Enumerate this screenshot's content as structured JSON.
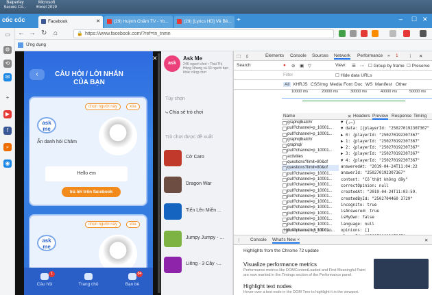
{
  "desktop": {
    "items": [
      {
        "label": "Balperfey\nSecure Co..."
      },
      {
        "label": "Microsoft\nExcel 2019"
      }
    ]
  },
  "browser": {
    "brand": "cốc cốc",
    "tabs": [
      {
        "label": "Facebook",
        "color": "#3b5998"
      },
      {
        "label": "(29) Huỳnh Chăm TV - Yo...",
        "color": "#e53935"
      },
      {
        "label": "(29) [Lyrics HD] Về Bê...",
        "color": "#e53935"
      }
    ],
    "new_tab": "+",
    "url": "https://www.facebook.com/?ref=tn_tnmn",
    "bookmark_label": "Ứng dụng"
  },
  "game": {
    "title": "CÂU HỎI / LỜI NHẮN CỦA BẠN",
    "back_icon": "‹",
    "card1": {
      "choose": "chọn người này",
      "delete": "xóa",
      "logo": "ask me",
      "prompt": "Ẩn danh hỏi Chăm",
      "answer": "Hello em",
      "fb_button": "trả lời trên facebook"
    },
    "card2": {
      "choose": "chọn người này",
      "delete": "xóa",
      "logo": "ask me"
    },
    "nav": [
      {
        "label": "Câu hỏi",
        "badge": "1"
      },
      {
        "label": "Trang chủ",
        "badge": ""
      },
      {
        "label": "Bạn bè",
        "badge": "84"
      }
    ]
  },
  "fb_sidebar": {
    "app_name": "Ask Me",
    "app_meta": "24K người chơi • Thái Thị Hồng Nhung và 30 người bạn khác cũng chơi",
    "section_options": "Tùy chọn",
    "share_label": "Chia sẻ trò chơi",
    "section_suggested": "Trò chơi được đề xuất",
    "games": [
      {
        "name": "Cờ Caro",
        "color": "#c0392b"
      },
      {
        "name": "Dragon War",
        "color": "#6d4c41"
      },
      {
        "name": "Tiến Lên Miền ...",
        "color": "#1565c0"
      },
      {
        "name": "Jumpy Jumpy - ...",
        "color": "#7cb342"
      },
      {
        "name": "Liêng - 3 Cây -...",
        "color": "#8e24aa"
      }
    ]
  },
  "devtools": {
    "main_tabs": [
      "Elements",
      "Console",
      "Sources",
      "Network",
      "Performance",
      "»"
    ],
    "errors": "1",
    "filter_placeholder": "Filter",
    "hide_data_urls": "Hide data URLs",
    "view_label": "View:",
    "group_by_frame": "Group by frame",
    "preserve_log": "Preserve",
    "search_label": "Search",
    "type_filters": [
      "All",
      "XHR",
      "JS",
      "CSS",
      "Img",
      "Media",
      "Font",
      "Doc",
      "WS",
      "Manifest",
      "Other"
    ],
    "timeline_ticks": [
      "10000 ms",
      "20000 ms",
      "30000 ms",
      "40000 ms",
      "50000 ms"
    ],
    "name_header": "Name",
    "detail_tabs": [
      "Headers",
      "Preview",
      "Response",
      "Timing"
    ],
    "requests": [
      "graphqlbatch/",
      "pull?channel=p_10001...",
      "pull?channel=p_10001...",
      "graphqlbatch/",
      "graphql/",
      "pull?channel=p_10001...",
      "activities",
      "questions?limit=80&of",
      "questions?limit=80&of",
      "pull?channel=p_10001...",
      "pull?channel=p_10001...",
      "pull?channel=p_10001...",
      "pull?channel=p_10001...",
      "pull?channel=p_10001...",
      "pull?channel=p_10001...",
      "pull?channel=p_10001...",
      "pull?channel=p_10001...",
      "pull?channel=p_10001...",
      "pull?channel=p_10001...",
      "pull?channel=p_10001..."
    ],
    "status_bar": "188 requests | 1.5 MB tran...",
    "preview_lines": [
      "▼ {,…}",
      "▼ data: [{playerId: \"250270192307367\"",
      "  ▶ 0: {playerId: \"250270192307367\"",
      "  ▶ 1: {playerId: \"250270192307367\"",
      "  ▶ 2: {playerId: \"250270192307367\"",
      "  ▶ 3: {playerId: \"250270192307367\"",
      "  ▼ 4: {playerId: \"250270192307367\"",
      "     answeredAt: \"2019-04-24T11:04:22",
      "     answerId: \"250270192307367\"",
      "     content: \"Cố thật không đây\"",
      "     correctOpinion: null",
      "     createdAt: \"2019-04-24T11:03:59.",
      "     createdById: \"2502704460 3729\"",
      "     incognito: true",
      "     isAnswered: true",
      "     isMyOwn: false",
      "     language: null",
      "     opinions: []",
      "     playerId: \"250270192307367\"",
      "     type: \"text\""
    ],
    "console_tabs": [
      "Console",
      "What's New ×"
    ],
    "console_heading": "Highlights from the Chrome 72 update",
    "console_items": [
      {
        "title": "Visualize performance metrics",
        "desc": "Performance metrics like DOMContentLoaded and First Meaningful Paint are now marked in the Timings section of the Performance panel."
      },
      {
        "title": "Highlight text nodes",
        "desc": "Hover over a text node in the DOM Tree to highlight it in the viewport."
      }
    ]
  }
}
